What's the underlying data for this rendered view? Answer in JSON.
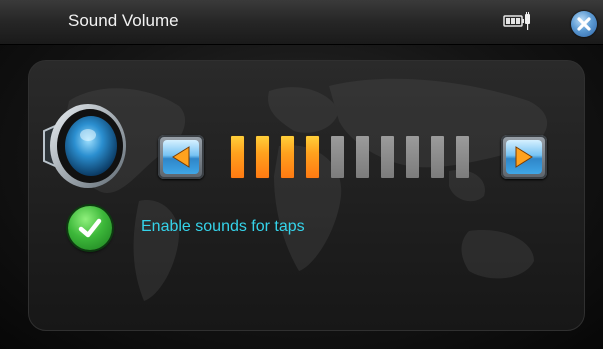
{
  "header": {
    "title": "Sound Volume",
    "battery_icon": "battery-charging-icon",
    "close_icon": "close-icon"
  },
  "volume": {
    "speaker_icon": "speaker-icon",
    "decrease_icon": "arrow-left-icon",
    "increase_icon": "arrow-right-icon",
    "level": 4,
    "max": 10,
    "active_color": "#ff9a1c",
    "inactive_color": "#8a8a8a"
  },
  "tap_sounds": {
    "label": "Enable sounds for taps",
    "checked": true,
    "icon": "checkmark-icon",
    "label_color": "#35d3ea"
  }
}
